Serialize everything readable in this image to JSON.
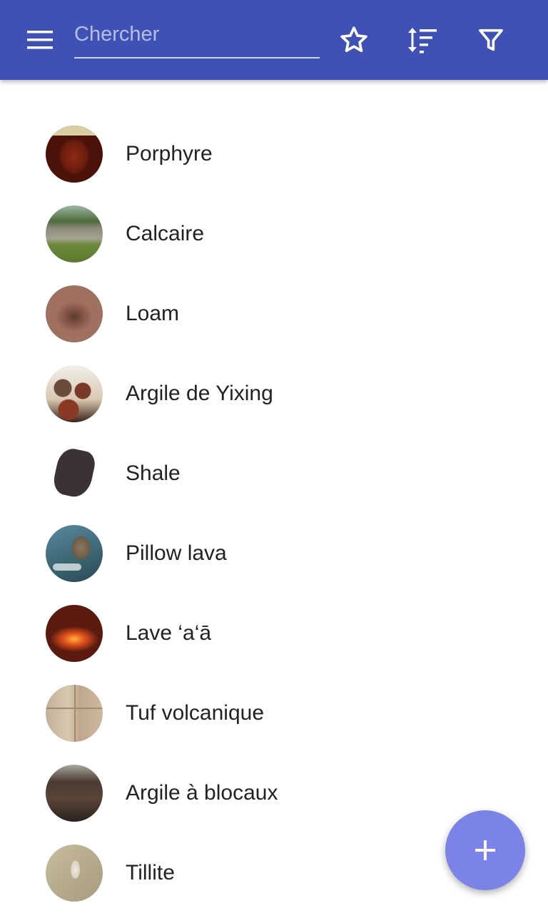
{
  "toolbar": {
    "menu_icon": "menu-icon",
    "search": {
      "value": "",
      "placeholder": "Chercher"
    },
    "actions": [
      "star-icon",
      "sort-icon",
      "filter-icon"
    ]
  },
  "colors": {
    "appbar": "#3f51b5",
    "fab": "#7b84e6",
    "text": "#222222"
  },
  "rocks": [
    {
      "label": "Porphyre",
      "thumb": "porphyre"
    },
    {
      "label": "Calcaire",
      "thumb": "calcaire"
    },
    {
      "label": "Loam",
      "thumb": "loam"
    },
    {
      "label": "Argile de Yixing",
      "thumb": "yixing"
    },
    {
      "label": "Shale",
      "thumb": "shale"
    },
    {
      "label": "Pillow lava",
      "thumb": "pillow"
    },
    {
      "label": "Lave ‘a‘ā",
      "thumb": "lava"
    },
    {
      "label": "Tuf volcanique",
      "thumb": "tuf"
    },
    {
      "label": "Argile à blocaux",
      "thumb": "blocaux"
    },
    {
      "label": "Tillite",
      "thumb": "tillite"
    }
  ],
  "fab": {
    "icon": "plus-icon"
  }
}
